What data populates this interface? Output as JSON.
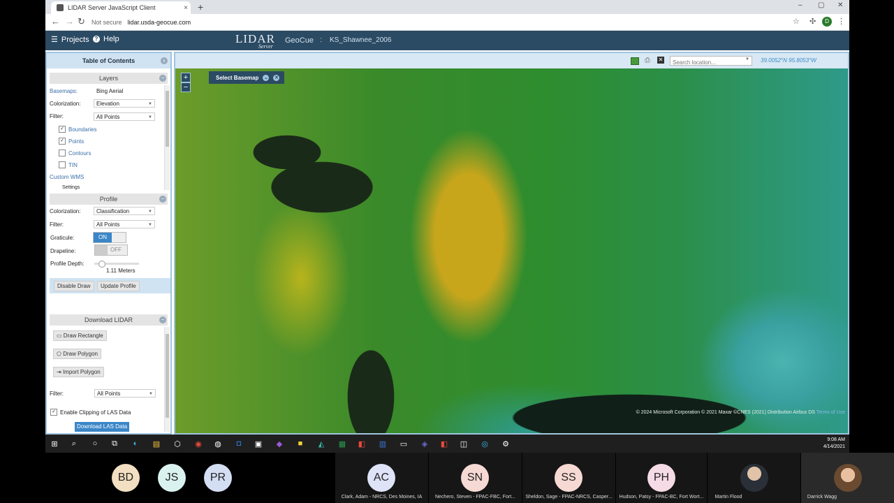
{
  "browser": {
    "tab_title": "LIDAR Server JavaScript Client",
    "tab_close": "×",
    "new_tab": "+",
    "win_min": "–",
    "win_max": "▢",
    "win_close": "✕",
    "not_secure": "Not secure",
    "url": "lidar.usda-geocue.com",
    "profile_initial": "D"
  },
  "header": {
    "projects": "Projects",
    "help": "Help",
    "logo": "LIDAR",
    "logo_sub": "Server",
    "app": "GeoCue",
    "separator": ":",
    "project": "KS_Shawnee_2006"
  },
  "toc": {
    "title": "Table of Contents",
    "layers": {
      "title": "Layers",
      "basemaps_label": "Basemaps:",
      "basemaps_value": "Bing Aerial",
      "colorization_label": "Colorization:",
      "colorization_value": "Elevation",
      "filter_label": "Filter:",
      "filter_value": "All Points",
      "items": [
        {
          "label": "Boundaries",
          "checked": true
        },
        {
          "label": "Points",
          "checked": true
        },
        {
          "label": "Contours",
          "checked": false
        },
        {
          "label": "TIN",
          "checked": false
        }
      ],
      "custom_wms": "Custom WMS",
      "settings": "Settings"
    },
    "profile": {
      "title": "Profile",
      "colorization_label": "Colorization:",
      "colorization_value": "Classification",
      "filter_label": "Filter:",
      "filter_value": "All Points",
      "graticule_label": "Graticule:",
      "graticule_value": "ON",
      "drapeline_label": "Drapeline:",
      "drapeline_value": "OFF",
      "depth_label": "Profile Depth:",
      "depth_value": "1.11 Meters",
      "disable_draw": "Disable Draw",
      "update_profile": "Update Profile"
    },
    "download": {
      "title": "Download LIDAR",
      "draw_rectangle": "Draw Rectangle",
      "draw_polygon": "Draw Polygon",
      "import_polygon": "Import Polygon",
      "filter_label": "Filter:",
      "filter_value": "All Points",
      "clip_label": "Enable Clipping of LAS Data",
      "download_button": "Download LAS Data"
    }
  },
  "map": {
    "search_placeholder": "Search location...",
    "coords": "39.0052°N 95.8053°W",
    "select_basemap": "Select Basemap",
    "zoom_in": "+",
    "zoom_out": "−",
    "copyright": "© 2024 Microsoft Corporation © 2021 Maxar ©CNES (2021) Distribution Airbus DS",
    "terms": "Terms of Use"
  },
  "taskbar": {
    "time": "9:08 AM",
    "date": "4/14/2021"
  },
  "participants": [
    {
      "initials": "BD",
      "name": "",
      "color": "#f3dfc1"
    },
    {
      "initials": "JS",
      "name": "",
      "color": "#d9f2f0"
    },
    {
      "initials": "PR",
      "name": "",
      "color": "#d3def3"
    },
    {
      "initials": "AC",
      "name": "Clark, Adam - NRCS, Des Moines, IA",
      "color": "#dfe3f7"
    },
    {
      "initials": "SN",
      "name": "Nechero, Steven - FPAC-FBC, Fort...",
      "color": "#f7d9d4"
    },
    {
      "initials": "SS",
      "name": "Sheldon, Sage - FPAC-NRCS, Casper...",
      "color": "#f7d9d4"
    },
    {
      "initials": "PH",
      "name": "Hudson, Patsy - FPAC-BC, Fort Wort...",
      "color": "#f5dbe6"
    },
    {
      "initials": "",
      "name": "Martin Flood",
      "color": "#8a8f96"
    },
    {
      "initials": "",
      "name": "Darrick Wagg",
      "color": "#c9a585"
    }
  ]
}
